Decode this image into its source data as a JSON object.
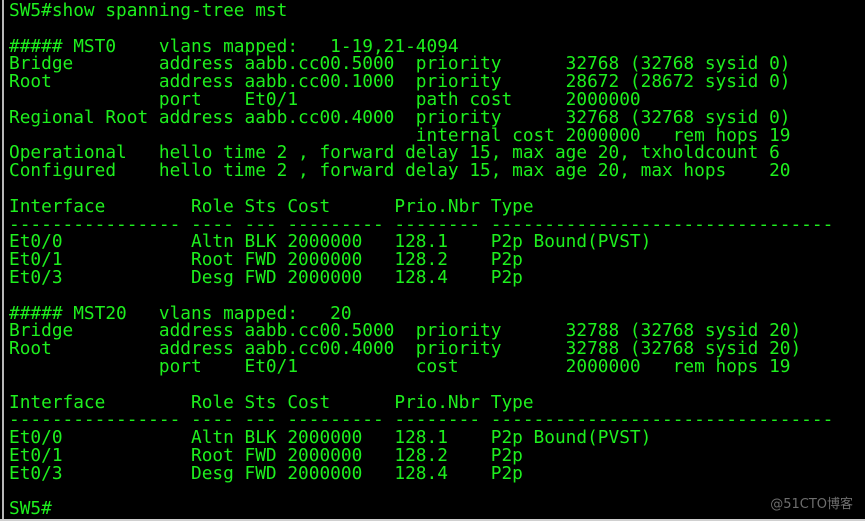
{
  "terminal": {
    "text_color": "#1ef01e",
    "background": "#000000",
    "lines": [
      "SW5#show spanning-tree mst",
      "",
      "##### MST0    vlans mapped:   1-19,21-4094",
      "Bridge        address aabb.cc00.5000  priority      32768 (32768 sysid 0)",
      "Root          address aabb.cc00.1000  priority      28672 (28672 sysid 0)",
      "              port    Et0/1           path cost     2000000",
      "Regional Root address aabb.cc00.4000  priority      32768 (32768 sysid 0)",
      "                                      internal cost 2000000   rem hops 19",
      "Operational   hello time 2 , forward delay 15, max age 20, txholdcount 6",
      "Configured    hello time 2 , forward delay 15, max age 20, max hops    20",
      "",
      "Interface        Role Sts Cost      Prio.Nbr Type",
      "---------------- ---- --- --------- -------- --------------------------------",
      "Et0/0            Altn BLK 2000000   128.1    P2p Bound(PVST)",
      "Et0/1            Root FWD 2000000   128.2    P2p",
      "Et0/3            Desg FWD 2000000   128.4    P2p",
      "",
      "##### MST20   vlans mapped:   20",
      "Bridge        address aabb.cc00.5000  priority      32788 (32768 sysid 20)",
      "Root          address aabb.cc00.4000  priority      32788 (32768 sysid 20)",
      "              port    Et0/1           cost          2000000   rem hops 19",
      "",
      "Interface        Role Sts Cost      Prio.Nbr Type",
      "---------------- ---- --- --------- -------- --------------------------------",
      "Et0/0            Altn BLK 2000000   128.1    P2p Bound(PVST)",
      "Et0/1            Root FWD 2000000   128.2    P2p",
      "Et0/3            Desg FWD 2000000   128.4    P2p",
      "",
      "SW5#"
    ]
  },
  "watermark": "@51CTO博客"
}
